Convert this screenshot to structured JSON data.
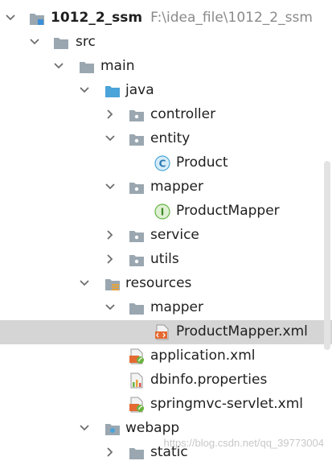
{
  "tree": {
    "root": {
      "name": "1012_2_ssm",
      "path": "F:\\idea_file\\1012_2_ssm"
    },
    "nodes": [
      {
        "label": "src"
      },
      {
        "label": "main"
      },
      {
        "label": "java"
      },
      {
        "label": "controller"
      },
      {
        "label": "entity"
      },
      {
        "label": "Product",
        "badge": "C"
      },
      {
        "label": "mapper"
      },
      {
        "label": "ProductMapper",
        "badge": "I"
      },
      {
        "label": "service"
      },
      {
        "label": "utils"
      },
      {
        "label": "resources"
      },
      {
        "label": "mapper"
      },
      {
        "label": "ProductMapper.xml"
      },
      {
        "label": "application.xml"
      },
      {
        "label": "dbinfo.properties"
      },
      {
        "label": "springmvc-servlet.xml"
      },
      {
        "label": "webapp"
      },
      {
        "label": "static"
      }
    ]
  },
  "watermark": "https://blog.csdn.net/qq_39773004",
  "colors": {
    "folder": "#9aa7b0",
    "source_folder": "#4aa3d9",
    "class_badge": "#48a5d8",
    "interface_badge": "#62b543",
    "xml": "#e46a32",
    "selection": "#d5d5d5"
  }
}
